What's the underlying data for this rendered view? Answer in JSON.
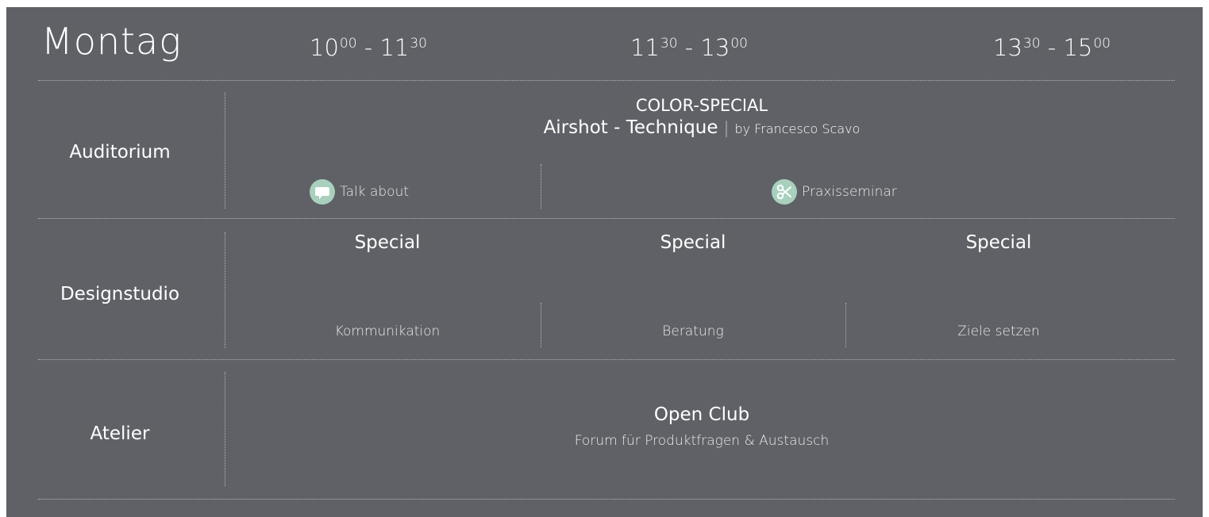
{
  "header": {
    "day": "Montag",
    "slots": [
      {
        "start_main": "10",
        "start_sup": "00",
        "end_main": "11",
        "end_sup": "30"
      },
      {
        "start_main": "11",
        "start_sup": "30",
        "end_main": "13",
        "end_sup": "00"
      },
      {
        "start_main": "13",
        "start_sup": "30",
        "end_main": "15",
        "end_sup": "00"
      }
    ],
    "separator": "-"
  },
  "rooms": {
    "auditorium": {
      "name": "Auditorium",
      "event_line1": "COLOR-SPECIAL",
      "event_title": "Airshot - Technique",
      "event_pipe": "|",
      "event_by": "by Francesco Scavo",
      "sessions": [
        {
          "label": "Talk about",
          "icon": "speech-bubble-icon"
        },
        {
          "label": "Praxisseminar",
          "icon": "scissors-icon"
        }
      ]
    },
    "designstudio": {
      "name": "Designstudio",
      "slots": [
        {
          "title": "Special",
          "subtitle": "Kommunikation"
        },
        {
          "title": "Special",
          "subtitle": "Beratung"
        },
        {
          "title": "Special",
          "subtitle": "Ziele setzen"
        }
      ]
    },
    "atelier": {
      "name": "Atelier",
      "title": "Open Club",
      "subtitle": "Forum für Produktfragen & Austausch"
    }
  },
  "colors": {
    "panel_bg": "#5f6166",
    "text": "#ffffff",
    "icon_badge": "#a8d0bd",
    "divider": "#b4b6b9"
  }
}
